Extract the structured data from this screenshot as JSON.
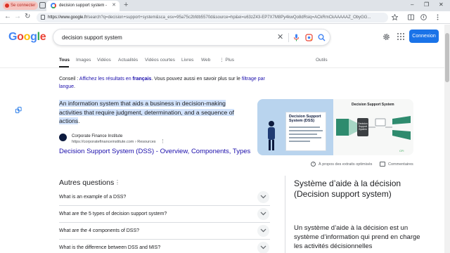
{
  "browser": {
    "profile_label": "Se connecter",
    "tab_title": "decision support system - Recherche Google",
    "url_host": "https://www.google.fr",
    "url_path": "/search?q=decision+support+system&sca_esv=95a75c2bfdb5570d&source=hp&ei=u63zZ43-EP7X7M8Py4kwQo8dRsiq=ACkRmCkAAAAAZ_ObyGG..."
  },
  "google": {
    "logo": [
      "G",
      "o",
      "o",
      "g",
      "l",
      "e"
    ],
    "search_value": "decision support system",
    "login_label": "Connexion",
    "tabs": [
      "Tous",
      "Images",
      "Vidéos",
      "Actualités",
      "Vidéos courtes",
      "Livres",
      "Web",
      "Plus",
      "Outils"
    ],
    "more_glyph": "⋮"
  },
  "spelling": {
    "prefix": "Conseil : ",
    "link1": "Affichez les résultats en ",
    "link1_lang": "français",
    "middle": ". Vous pouvez aussi en savoir plus sur le ",
    "link2": "filtrage par langue",
    "end": "."
  },
  "featured": {
    "answer": "An information system that aids a business in decision-making activities that require judgment, determination, and a sequence of actions",
    "answer_end": ".",
    "source_name": "Corporate Finance Institute",
    "source_url": "https://corporatefinanceinstitute.com › Resources",
    "source_menu": "⋮",
    "result_title": "Decision Support System (DSS) - Overview, Components, Types",
    "image_card_title": "Decision Support System (DSS)",
    "image_right_title": "Decision Support System",
    "image_center_label": "Decision Support System",
    "image_brand": "CFI",
    "about_label": "À propos des extraits optimisés",
    "comments_label": "Commentaires"
  },
  "paa": {
    "title": "Autres questions",
    "menu": "⋮",
    "questions": [
      "What is an example of a DSS?",
      "What are the 5 types of decision support system?",
      "What are the 4 components of DSS?",
      "What is the difference between DSS and MIS?"
    ]
  },
  "knowledge_panel": {
    "title": "Système d’aide à la décision (Decision support system)",
    "text": "Un système d’aide à la décision est un système d’information qui prend en charge les activités décisionnelles"
  },
  "colors": {
    "accent": "#1a73e8",
    "link": "#1a0dab",
    "highlight": "#d2e3fc",
    "profile_bg": "#f6c5c0"
  }
}
